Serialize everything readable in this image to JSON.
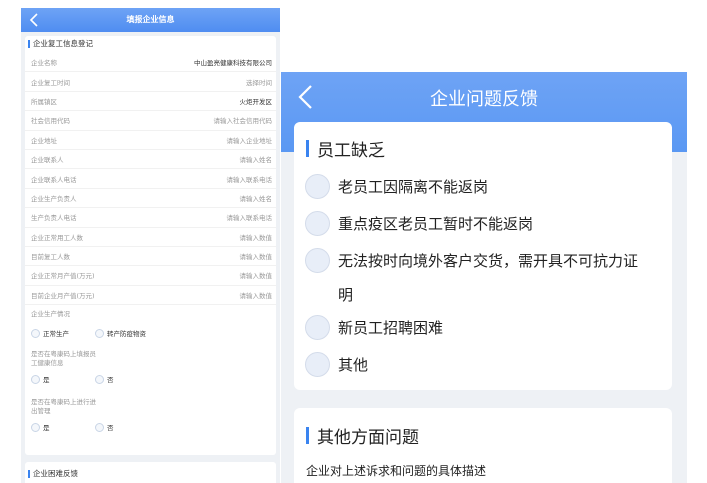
{
  "left": {
    "header_title": "填报企业信息",
    "section1_title": "企业复工信息登记",
    "rows": [
      {
        "label": "企业名称",
        "value": "中山盈亮健康科技有限公司",
        "filled": true
      },
      {
        "label": "企业复工时间",
        "value": "选择时间",
        "filled": false
      },
      {
        "label": "所属镇区",
        "value": "火炬开发区",
        "filled": true
      },
      {
        "label": "社会信用代码",
        "value": "请输入社会信用代码",
        "filled": false
      },
      {
        "label": "企业地址",
        "value": "请输入企业地址",
        "filled": false
      },
      {
        "label": "企业联系人",
        "value": "请输入姓名",
        "filled": false
      },
      {
        "label": "企业联系人电话",
        "value": "请输入联系电话",
        "filled": false
      },
      {
        "label": "企业生产负责人",
        "value": "请输入姓名",
        "filled": false
      },
      {
        "label": "生产负责人电话",
        "value": "请输入联系电话",
        "filled": false
      },
      {
        "label": "企业正常用工人数",
        "value": "请输入数值",
        "filled": false
      },
      {
        "label": "目前复工人数",
        "value": "请输入数值",
        "filled": false
      },
      {
        "label": "企业正常月产值(万元)",
        "value": "请输入数值",
        "filled": false
      },
      {
        "label": "目前企业月产值(万元)",
        "value": "请输入数值",
        "filled": false
      }
    ],
    "production_status": {
      "label": "企业生产情况",
      "options": [
        "正常生产",
        "转产防疫物资"
      ]
    },
    "health_info_q": {
      "label_lines": [
        "是否在粤康码上填报员",
        "工健康信息"
      ],
      "options": [
        "是",
        "否"
      ]
    },
    "entry_q": {
      "label_lines": [
        "是否在粤康码上进行进",
        "出管理"
      ],
      "options": [
        "是",
        "否"
      ]
    },
    "section2_title": "企业困难反馈"
  },
  "right": {
    "header_title": "企业问题反馈",
    "section1_title": "员工缺乏",
    "options": [
      {
        "lines": [
          "老员工因隔离不能返岗"
        ]
      },
      {
        "lines": [
          "重点疫区老员工暂时不能返岗"
        ]
      },
      {
        "lines": [
          "无法按时向境外客户交货，需开具不可抗力证",
          "明"
        ]
      },
      {
        "lines": [
          "新员工招聘困难"
        ]
      },
      {
        "lines": [
          "其他"
        ]
      }
    ],
    "section2_title": "其他方面问题",
    "desc_label": "企业对上述诉求和问题的具体描述"
  },
  "colors": {
    "accent": "#3a84f0",
    "header": "#5a98f3"
  }
}
